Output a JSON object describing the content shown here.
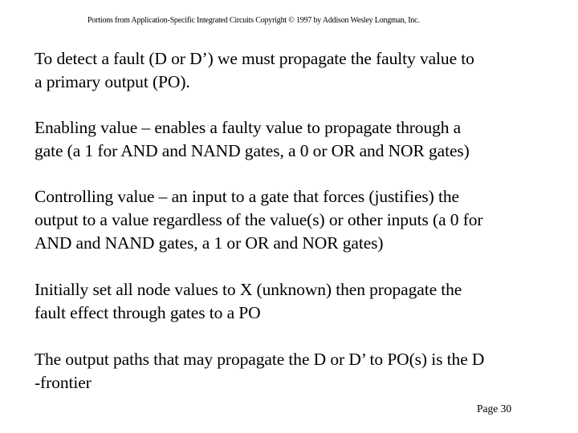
{
  "header": {
    "copyright": "Portions from Application-Specific Integrated Circuits Copyright © 1997 by Addison Wesley Longman, Inc."
  },
  "paragraphs": [
    {
      "lines": [
        "To detect a fault (D or D’) we must propagate the faulty value to",
        "a primary output (PO)."
      ]
    },
    {
      "lines": [
        "Enabling value – enables a faulty value to propagate through a",
        "gate (a 1 for AND and NAND gates, a 0 or OR and NOR gates)"
      ]
    },
    {
      "lines": [
        "Controlling value – an input to a gate that forces (justifies) the",
        "output to a value regardless of the value(s) or other inputs (a 0 for",
        "AND and NAND gates, a 1 or OR and NOR gates)"
      ]
    },
    {
      "lines": [
        "Initially set all node values to X (unknown) then propagate the",
        "fault effect through gates to a PO"
      ]
    },
    {
      "lines": [
        "The output paths that may propagate the D or D’ to PO(s) is the D",
        "-frontier"
      ]
    }
  ],
  "footer": {
    "page_label": "Page 30"
  }
}
